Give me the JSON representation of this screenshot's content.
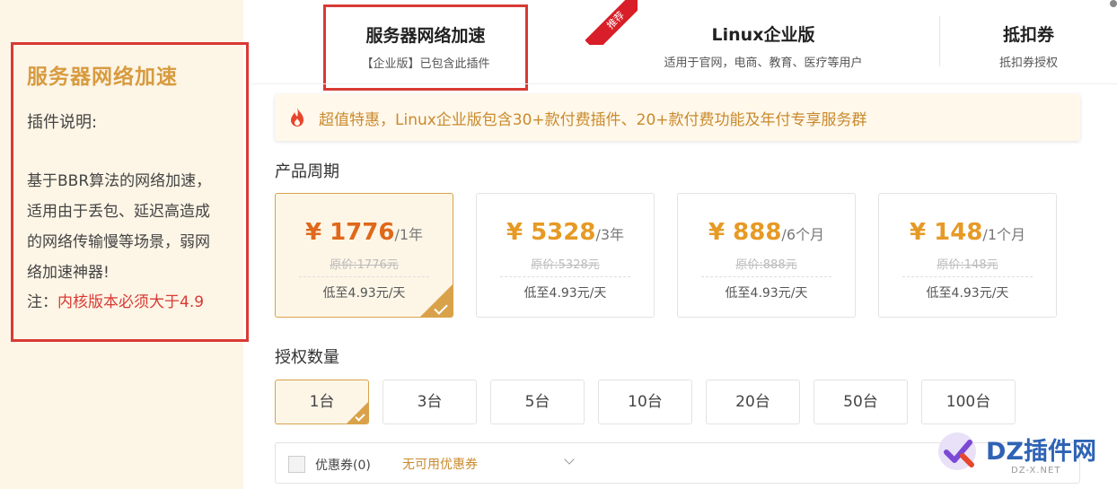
{
  "left_panel": {
    "title": "服务器网络加速",
    "subtitle": "插件说明:",
    "description": "基于BBR算法的网络加速，适用由于丢包、延迟高造成的网络传输慢等场景，弱网络加速神器!",
    "note_prefix": "注：",
    "note_warning": "内核版本必须大于4.9"
  },
  "tabs": [
    {
      "title": "服务器网络加速",
      "desc": "【企业版】已包含此插件"
    },
    {
      "title": "Linux企业版",
      "desc": "适用于官网，电商、教育、医疗等用户",
      "badge": "推荐"
    },
    {
      "title": "抵扣券",
      "desc": "抵扣券授权"
    }
  ],
  "promo": {
    "text": "超值特惠，Linux企业版包含30+款付费插件、20+款付费功能及年付专享服务群"
  },
  "period": {
    "label": "产品周期",
    "options": [
      {
        "price": "¥ 1776",
        "unit": "/1年",
        "original": "原价:1776元",
        "daily": "低至4.93元/天",
        "selected": true
      },
      {
        "price": "¥ 5328",
        "unit": "/3年",
        "original": "原价:5328元",
        "daily": "低至4.93元/天",
        "selected": false
      },
      {
        "price": "¥ 888",
        "unit": "/6个月",
        "original": "原价:888元",
        "daily": "低至4.93元/天",
        "selected": false
      },
      {
        "price": "¥ 148",
        "unit": "/1个月",
        "original": "原价:148元",
        "daily": "低至4.93元/天",
        "selected": false
      }
    ]
  },
  "quantity": {
    "label": "授权数量",
    "options": [
      "1台",
      "3台",
      "5台",
      "10台",
      "20台",
      "50台",
      "100台"
    ],
    "selected": "1台"
  },
  "coupon": {
    "label": "优惠券(0)",
    "value": "无可用优惠券"
  },
  "watermark": {
    "text": "DZ插件网",
    "sub": "DZ-X.NET"
  },
  "colors": {
    "accent": "#d9a24a",
    "highlight_red": "#d83a34",
    "price_orange": "#e69a25",
    "selected_price": "#e0681b",
    "brand_blue": "#2e63b5"
  }
}
